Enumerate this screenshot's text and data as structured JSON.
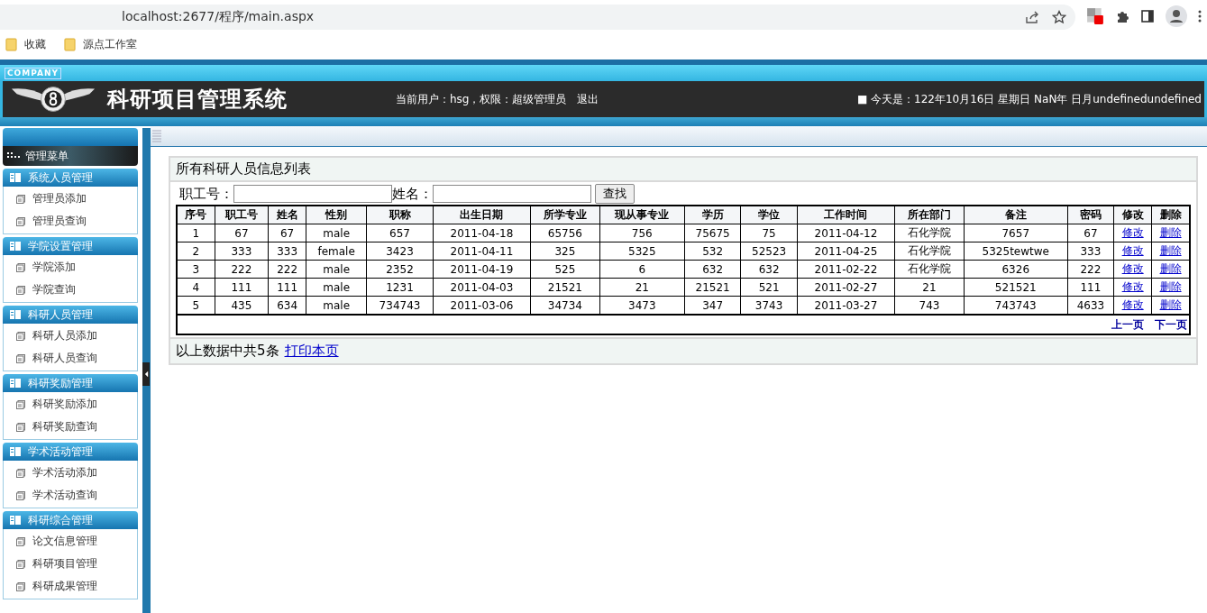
{
  "browser": {
    "url": "localhost:2677/程序/main.aspx",
    "bookmarks": [
      "收藏",
      "源点工作室"
    ]
  },
  "header": {
    "company_badge": "COMPANY",
    "title": "科研项目管理系统",
    "user_info": "当前用户：hsg，权限：超级管理员",
    "logout": "退出",
    "date": "■ 今天是：122年10月16日 星期日 NaN年 日月undefinedundefined"
  },
  "sidebar": {
    "title": "管理菜单",
    "groups": [
      {
        "title": "系统人员管理",
        "items": [
          "管理员添加",
          "管理员查询"
        ]
      },
      {
        "title": "学院设置管理",
        "items": [
          "学院添加",
          "学院查询"
        ]
      },
      {
        "title": "科研人员管理",
        "items": [
          "科研人员添加",
          "科研人员查询"
        ]
      },
      {
        "title": "科研奖励管理",
        "items": [
          "科研奖励添加",
          "科研奖励查询"
        ]
      },
      {
        "title": "学术活动管理",
        "items": [
          "学术活动添加",
          "学术活动查询"
        ]
      },
      {
        "title": "科研综合管理",
        "items": [
          "论文信息管理",
          "科研项目管理",
          "科研成果管理"
        ]
      }
    ]
  },
  "content": {
    "title": "所有科研人员信息列表",
    "search": {
      "fields": [
        {
          "label": "职工号："
        },
        {
          "label": "姓名："
        }
      ],
      "button": "查找"
    },
    "table": {
      "columns": [
        {
          "label": "序号",
          "kind": "text"
        },
        {
          "label": "职工号",
          "kind": "text"
        },
        {
          "label": "姓名",
          "kind": "text"
        },
        {
          "label": "性别",
          "kind": "text"
        },
        {
          "label": "职称",
          "kind": "text"
        },
        {
          "label": "出生日期",
          "kind": "text"
        },
        {
          "label": "所学专业",
          "kind": "text"
        },
        {
          "label": "现从事专业",
          "kind": "text"
        },
        {
          "label": "学历",
          "kind": "text"
        },
        {
          "label": "学位",
          "kind": "text"
        },
        {
          "label": "工作时间",
          "kind": "text"
        },
        {
          "label": "所在部门",
          "kind": "text"
        },
        {
          "label": "备注",
          "kind": "text"
        },
        {
          "label": "密码",
          "kind": "text"
        },
        {
          "label": "修改",
          "kind": "link"
        },
        {
          "label": "删除",
          "kind": "link"
        }
      ],
      "rows": [
        [
          "1",
          "67",
          "67",
          "male",
          "657",
          "2011-04-18",
          "65756",
          "756",
          "75675",
          "75",
          "2011-04-12",
          "石化学院",
          "7657",
          "67",
          "修改",
          "删除"
        ],
        [
          "2",
          "333",
          "333",
          "female",
          "3423",
          "2011-04-11",
          "325",
          "5325",
          "532",
          "52523",
          "2011-04-25",
          "石化学院",
          "5325tewtwe",
          "333",
          "修改",
          "删除"
        ],
        [
          "3",
          "222",
          "222",
          "male",
          "2352",
          "2011-04-19",
          "525",
          "6",
          "632",
          "632",
          "2011-02-22",
          "石化学院",
          "6326",
          "222",
          "修改",
          "删除"
        ],
        [
          "4",
          "111",
          "111",
          "male",
          "1231",
          "2011-04-03",
          "21521",
          "21",
          "21521",
          "521",
          "2011-02-27",
          "21",
          "521521",
          "111",
          "修改",
          "删除"
        ],
        [
          "5",
          "435",
          "634",
          "male",
          "734743",
          "2011-03-06",
          "34734",
          "3473",
          "347",
          "3743",
          "2011-03-27",
          "743",
          "743743",
          "4633",
          "修改",
          "删除"
        ]
      ]
    },
    "pager": [
      "上一页",
      "下一页"
    ],
    "footer": {
      "text": "以上数据中共5条",
      "link": "打印本页"
    }
  }
}
